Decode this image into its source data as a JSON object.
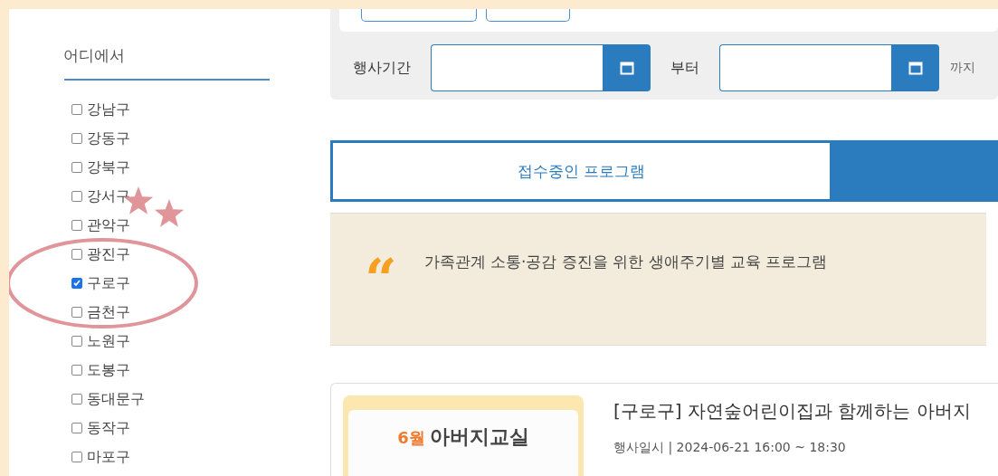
{
  "sidebar": {
    "title": "어디에서",
    "districts": [
      {
        "label": "강남구",
        "checked": false
      },
      {
        "label": "강동구",
        "checked": false
      },
      {
        "label": "강북구",
        "checked": false
      },
      {
        "label": "강서구",
        "checked": false
      },
      {
        "label": "관악구",
        "checked": false
      },
      {
        "label": "광진구",
        "checked": false
      },
      {
        "label": "구로구",
        "checked": true
      },
      {
        "label": "금천구",
        "checked": false
      },
      {
        "label": "노원구",
        "checked": false
      },
      {
        "label": "도봉구",
        "checked": false
      },
      {
        "label": "동대문구",
        "checked": false
      },
      {
        "label": "동작구",
        "checked": false
      },
      {
        "label": "마포구",
        "checked": false
      }
    ]
  },
  "search": {
    "period_label": "행사기간",
    "from_label": "부터",
    "to_label": "까지"
  },
  "tabs": [
    {
      "label": "접수중인 프로그램",
      "selected": false
    },
    {
      "selected": true
    }
  ],
  "banner": {
    "quote_mark": "“",
    "text": "가족관계 소통·공감 증진을 위한 생애주기별 교육 프로그램"
  },
  "program": {
    "thumbnail": {
      "month": "6월",
      "title": "아버지교실"
    },
    "title": "[구로구] 자연숲어린이집과 함께하는 아버지",
    "date": "행사일시 | 2024-06-21 16:00 ~ 18:30"
  }
}
